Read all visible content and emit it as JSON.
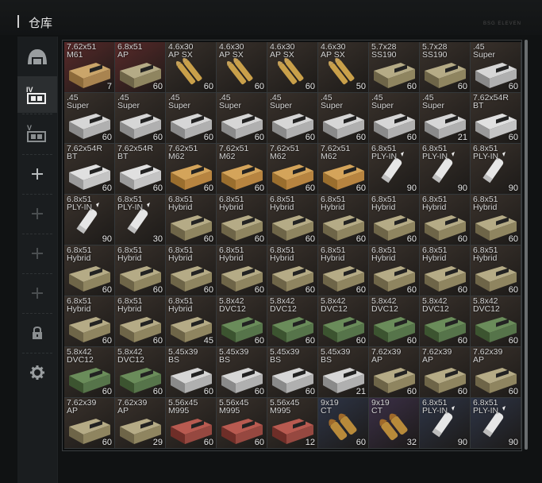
{
  "window": {
    "title": "仓库",
    "build_text": "BSG ELEVEN"
  },
  "sidebar": {
    "items": [
      {
        "icon": "helmet-icon",
        "active": false
      },
      {
        "icon": "stash-tab-4-icon",
        "label": "IV",
        "active": true
      },
      {
        "icon": "stash-tab-5-icon",
        "label": "V",
        "active": false
      },
      {
        "icon": "plus-icon"
      },
      {
        "icon": "plus-icon"
      },
      {
        "icon": "plus-icon"
      },
      {
        "icon": "plus-icon"
      },
      {
        "icon": "lock-icon"
      },
      {
        "icon": "gear-icon"
      }
    ]
  },
  "colors": {
    "accent": "#d6d6d6",
    "bg_brown": "#3a322c",
    "bg_red": "#5a2a2a",
    "bg_green": "#283424",
    "bg_blue": "#2e3547",
    "bg_purple": "#3c3048"
  },
  "stash": {
    "items": [
      {
        "name": "7.62x51\nM61",
        "count": "7",
        "bg": "red",
        "art": "box-m61"
      },
      {
        "name": "6.8x51\nAP",
        "count": "60",
        "bg": "red",
        "art": "box-tan"
      },
      {
        "name": "4.6x30\nAP SX",
        "count": "60",
        "bg": "brown",
        "art": "rounds"
      },
      {
        "name": "4.6x30\nAP SX",
        "count": "60",
        "bg": "brown",
        "art": "rounds"
      },
      {
        "name": "4.6x30\nAP SX",
        "count": "60",
        "bg": "brown",
        "art": "rounds"
      },
      {
        "name": "4.6x30\nAP SX",
        "count": "50",
        "bg": "brown",
        "art": "rounds"
      },
      {
        "name": "5.7x28\nSS190",
        "count": "60",
        "bg": "brown",
        "art": "box-tan"
      },
      {
        "name": "5.7x28\nSS190",
        "count": "60",
        "bg": "brown",
        "art": "box-tan"
      },
      {
        "name": ".45\nSuper",
        "count": "60",
        "bg": "brown",
        "art": "box-white"
      },
      {
        "name": ".45\nSuper",
        "count": "60",
        "bg": "brown",
        "art": "box-white"
      },
      {
        "name": ".45\nSuper",
        "count": "60",
        "bg": "brown",
        "art": "box-white"
      },
      {
        "name": ".45\nSuper",
        "count": "60",
        "bg": "brown",
        "art": "box-white"
      },
      {
        "name": ".45\nSuper",
        "count": "60",
        "bg": "brown",
        "art": "box-white"
      },
      {
        "name": ".45\nSuper",
        "count": "60",
        "bg": "brown",
        "art": "box-white"
      },
      {
        "name": ".45\nSuper",
        "count": "60",
        "bg": "brown",
        "art": "box-white"
      },
      {
        "name": ".45\nSuper",
        "count": "60",
        "bg": "brown",
        "art": "box-white"
      },
      {
        "name": ".45\nSuper",
        "count": "21",
        "bg": "brown",
        "art": "box-white"
      },
      {
        "name": "7.62x54R\nBT",
        "count": "60",
        "bg": "brown",
        "art": "box-bt"
      },
      {
        "name": "7.62x54R\nBT",
        "count": "60",
        "bg": "brown",
        "art": "box-bt"
      },
      {
        "name": "7.62x54R\nBT",
        "count": "60",
        "bg": "brown",
        "art": "box-bt"
      },
      {
        "name": "7.62x51\nM62",
        "count": "60",
        "bg": "brown",
        "art": "box-m62"
      },
      {
        "name": "7.62x51\nM62",
        "count": "60",
        "bg": "brown",
        "art": "box-m62"
      },
      {
        "name": "7.62x51\nM62",
        "count": "60",
        "bg": "brown",
        "art": "box-m62"
      },
      {
        "name": "7.62x51\nM62",
        "count": "60",
        "bg": "brown",
        "art": "box-m62"
      },
      {
        "name": "6.8x51\nPLY-IN",
        "count": "90",
        "bg": "brown",
        "art": "shell-white"
      },
      {
        "name": "6.8x51\nPLY-IN",
        "count": "90",
        "bg": "brown",
        "art": "shell-white"
      },
      {
        "name": "6.8x51\nPLY-IN",
        "count": "90",
        "bg": "brown",
        "art": "shell-white"
      },
      {
        "name": "6.8x51\nPLY-IN",
        "count": "90",
        "bg": "brown",
        "art": "shell-white"
      },
      {
        "name": "6.8x51\nPLY-IN",
        "count": "30",
        "bg": "brown",
        "art": "shell-white"
      },
      {
        "name": "6.8x51\nHybrid",
        "count": "60",
        "bg": "brown",
        "art": "box-tan"
      },
      {
        "name": "6.8x51\nHybrid",
        "count": "60",
        "bg": "brown",
        "art": "box-tan"
      },
      {
        "name": "6.8x51\nHybrid",
        "count": "60",
        "bg": "brown",
        "art": "box-tan"
      },
      {
        "name": "6.8x51\nHybrid",
        "count": "60",
        "bg": "brown",
        "art": "box-tan"
      },
      {
        "name": "6.8x51\nHybrid",
        "count": "60",
        "bg": "brown",
        "art": "box-tan"
      },
      {
        "name": "6.8x51\nHybrid",
        "count": "60",
        "bg": "brown",
        "art": "box-tan"
      },
      {
        "name": "6.8x51\nHybrid",
        "count": "60",
        "bg": "brown",
        "art": "box-tan"
      },
      {
        "name": "6.8x51\nHybrid",
        "count": "60",
        "bg": "brown",
        "art": "box-tan"
      },
      {
        "name": "6.8x51\nHybrid",
        "count": "60",
        "bg": "brown",
        "art": "box-tan"
      },
      {
        "name": "6.8x51\nHybrid",
        "count": "60",
        "bg": "brown",
        "art": "box-tan"
      },
      {
        "name": "6.8x51\nHybrid",
        "count": "60",
        "bg": "brown",
        "art": "box-tan"
      },
      {
        "name": "6.8x51\nHybrid",
        "count": "60",
        "bg": "brown",
        "art": "box-tan"
      },
      {
        "name": "6.8x51\nHybrid",
        "count": "60",
        "bg": "brown",
        "art": "box-tan"
      },
      {
        "name": "6.8x51\nHybrid",
        "count": "60",
        "bg": "brown",
        "art": "box-tan"
      },
      {
        "name": "6.8x51\nHybrid",
        "count": "60",
        "bg": "brown",
        "art": "box-tan"
      },
      {
        "name": "6.8x51\nHybrid",
        "count": "60",
        "bg": "brown",
        "art": "box-tan"
      },
      {
        "name": "6.8x51\nHybrid",
        "count": "60",
        "bg": "brown",
        "art": "box-tan"
      },
      {
        "name": "6.8x51\nHybrid",
        "count": "60",
        "bg": "brown",
        "art": "box-tan"
      },
      {
        "name": "6.8x51\nHybrid",
        "count": "45",
        "bg": "brown",
        "art": "box-tan"
      },
      {
        "name": "5.8x42\nDVC12",
        "count": "60",
        "bg": "brown",
        "art": "box-green"
      },
      {
        "name": "5.8x42\nDVC12",
        "count": "60",
        "bg": "brown",
        "art": "box-green"
      },
      {
        "name": "5.8x42\nDVC12",
        "count": "60",
        "bg": "brown",
        "art": "box-green"
      },
      {
        "name": "5.8x42\nDVC12",
        "count": "60",
        "bg": "brown",
        "art": "box-green"
      },
      {
        "name": "5.8x42\nDVC12",
        "count": "60",
        "bg": "brown",
        "art": "box-green"
      },
      {
        "name": "5.8x42\nDVC12",
        "count": "60",
        "bg": "brown",
        "art": "box-green"
      },
      {
        "name": "5.8x42\nDVC12",
        "count": "60",
        "bg": "brown",
        "art": "box-green"
      },
      {
        "name": "5.8x42\nDVC12",
        "count": "60",
        "bg": "brown",
        "art": "box-green"
      },
      {
        "name": "5.45x39\nBS",
        "count": "60",
        "bg": "brown",
        "art": "box-white"
      },
      {
        "name": "5.45x39\nBS",
        "count": "60",
        "bg": "brown",
        "art": "box-white"
      },
      {
        "name": "5.45x39\nBS",
        "count": "60",
        "bg": "brown",
        "art": "box-white"
      },
      {
        "name": "5.45x39\nBS",
        "count": "21",
        "bg": "brown",
        "art": "box-white"
      },
      {
        "name": "7.62x39\nAP",
        "count": "60",
        "bg": "brown",
        "art": "box-tan"
      },
      {
        "name": "7.62x39\nAP",
        "count": "60",
        "bg": "brown",
        "art": "box-tan"
      },
      {
        "name": "7.62x39\nAP",
        "count": "60",
        "bg": "brown",
        "art": "box-tan"
      },
      {
        "name": "7.62x39\nAP",
        "count": "60",
        "bg": "brown",
        "art": "box-tan"
      },
      {
        "name": "7.62x39\nAP",
        "count": "29",
        "bg": "brown",
        "art": "box-tan"
      },
      {
        "name": "5.56x45\nM995",
        "count": "60",
        "bg": "brown",
        "art": "box-red"
      },
      {
        "name": "5.56x45\nM995",
        "count": "60",
        "bg": "brown",
        "art": "box-red"
      },
      {
        "name": "5.56x45\nM995",
        "count": "12",
        "bg": "brown",
        "art": "box-red"
      },
      {
        "name": "9x19\nCT",
        "count": "60",
        "bg": "blue",
        "art": "rounds-fat"
      },
      {
        "name": "9x19\nCT",
        "count": "32",
        "bg": "purple",
        "art": "rounds-fat"
      },
      {
        "name": "6.8x51\nPLY-IN",
        "count": "90",
        "bg": "blue",
        "art": "shell-white"
      },
      {
        "name": "6.8x51\nPLY-IN",
        "count": "90",
        "bg": "blue",
        "art": "shell-white"
      }
    ]
  }
}
